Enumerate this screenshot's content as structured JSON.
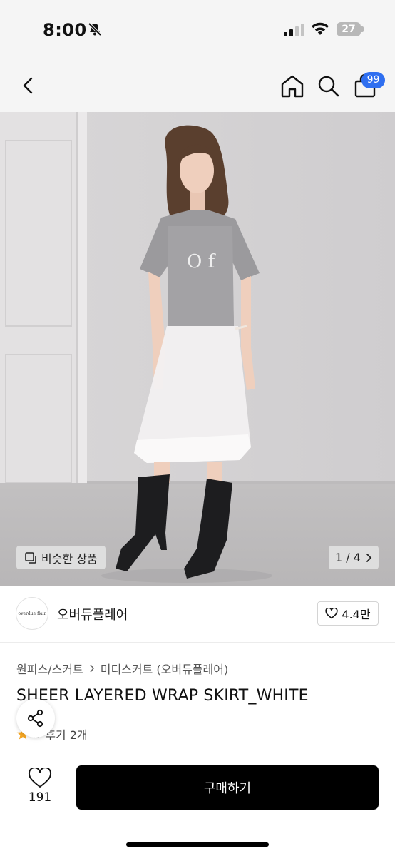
{
  "status_bar": {
    "time": "8:00",
    "battery": "27"
  },
  "nav": {
    "cart_badge": "99"
  },
  "product_image": {
    "similar_label": "비슷한 상품",
    "counter": "1 / 4"
  },
  "brand": {
    "logo_text": "overdue flair",
    "name": "오버듀플레어",
    "likes": "4.4만"
  },
  "product": {
    "breadcrumb": [
      "원피스/스커트",
      "미디스커트 (오버듀플레어)"
    ],
    "title": "SHEER LAYERED WRAP SKIRT_WHITE",
    "rating": "5",
    "review_link": "후기 2개"
  },
  "bottom_bar": {
    "wish_count": "191",
    "buy_label": "구매하기"
  },
  "colors": {
    "accent": "#2f6ff0",
    "star": "#f5a623",
    "buy_button": "#000000"
  }
}
